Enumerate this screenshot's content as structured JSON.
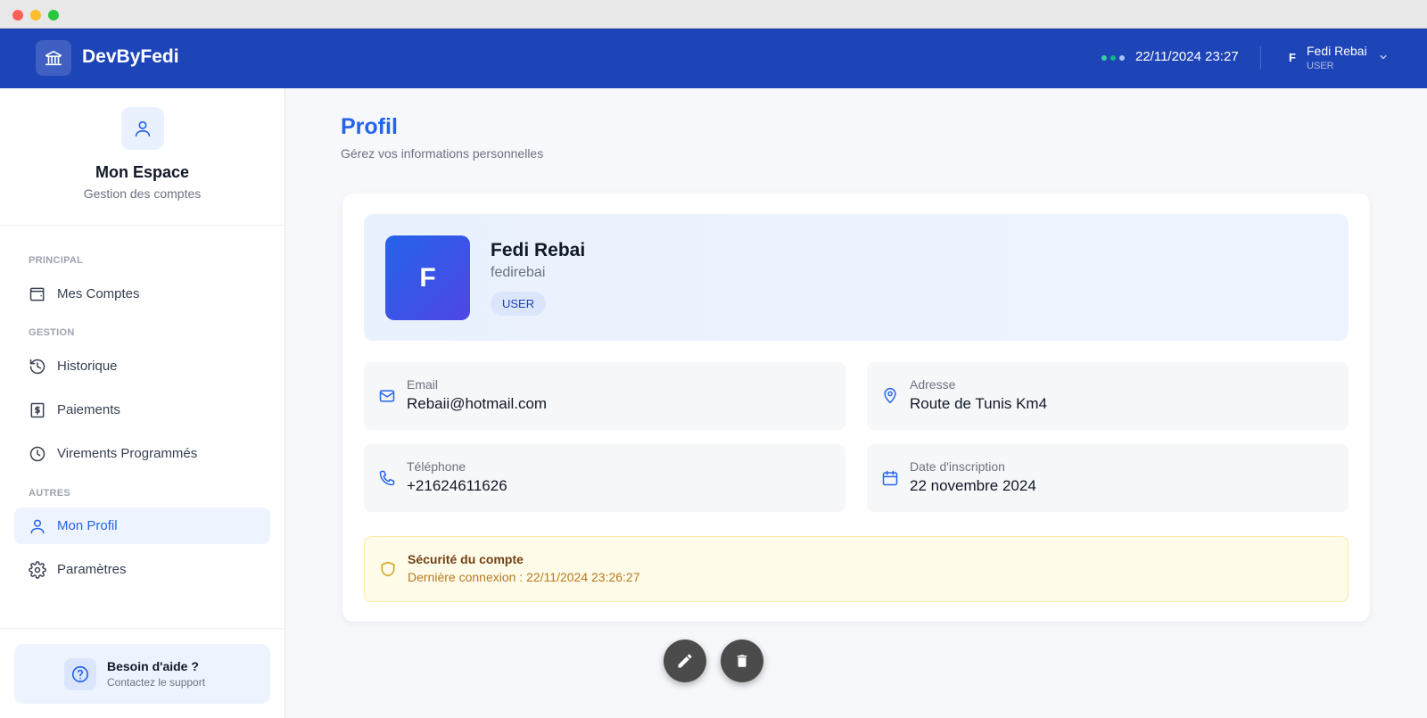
{
  "header": {
    "brand": "DevByFedi",
    "datetime": "22/11/2024 23:27",
    "user_initial": "F",
    "user_name": "Fedi Rebai",
    "user_role": "USER",
    "status_dot_colors": [
      "#34d399",
      "#10b981",
      "#a7c3f5"
    ]
  },
  "sidebar": {
    "title": "Mon Espace",
    "subtitle": "Gestion des comptes",
    "sections": {
      "principal": "PRINCIPAL",
      "gestion": "GESTION",
      "autres": "AUTRES"
    },
    "items": {
      "comptes": {
        "label": "Mes Comptes",
        "icon": "wallet-icon"
      },
      "historique": {
        "label": "Historique",
        "icon": "history-icon"
      },
      "paiements": {
        "label": "Paiements",
        "icon": "receipt-dollar-icon"
      },
      "virements": {
        "label": "Virements Programmés",
        "icon": "clock-icon"
      },
      "profil": {
        "label": "Mon Profil",
        "icon": "user-icon"
      },
      "parametres": {
        "label": "Paramètres",
        "icon": "gear-icon"
      }
    },
    "help": {
      "title": "Besoin d'aide ?",
      "subtitle": "Contactez le support"
    }
  },
  "main": {
    "title": "Profil",
    "subtitle": "Gérez vos informations personnelles",
    "profile": {
      "initial": "F",
      "name": "Fedi Rebai",
      "username": "fedirebai",
      "role": "USER"
    },
    "info": {
      "email": {
        "label": "Email",
        "value": "Rebaii@hotmail.com"
      },
      "address": {
        "label": "Adresse",
        "value": "Route de Tunis Km4"
      },
      "phone": {
        "label": "Téléphone",
        "value": "+21624611626"
      },
      "signup": {
        "label": "Date d'inscription",
        "value": "22 novembre 2024"
      }
    },
    "security": {
      "title": "Sécurité du compte",
      "last_login": "Dernière connexion : 22/11/2024 23:26:27"
    }
  },
  "colors": {
    "header_bg": "#1e45b8",
    "accent": "#2563eb"
  }
}
